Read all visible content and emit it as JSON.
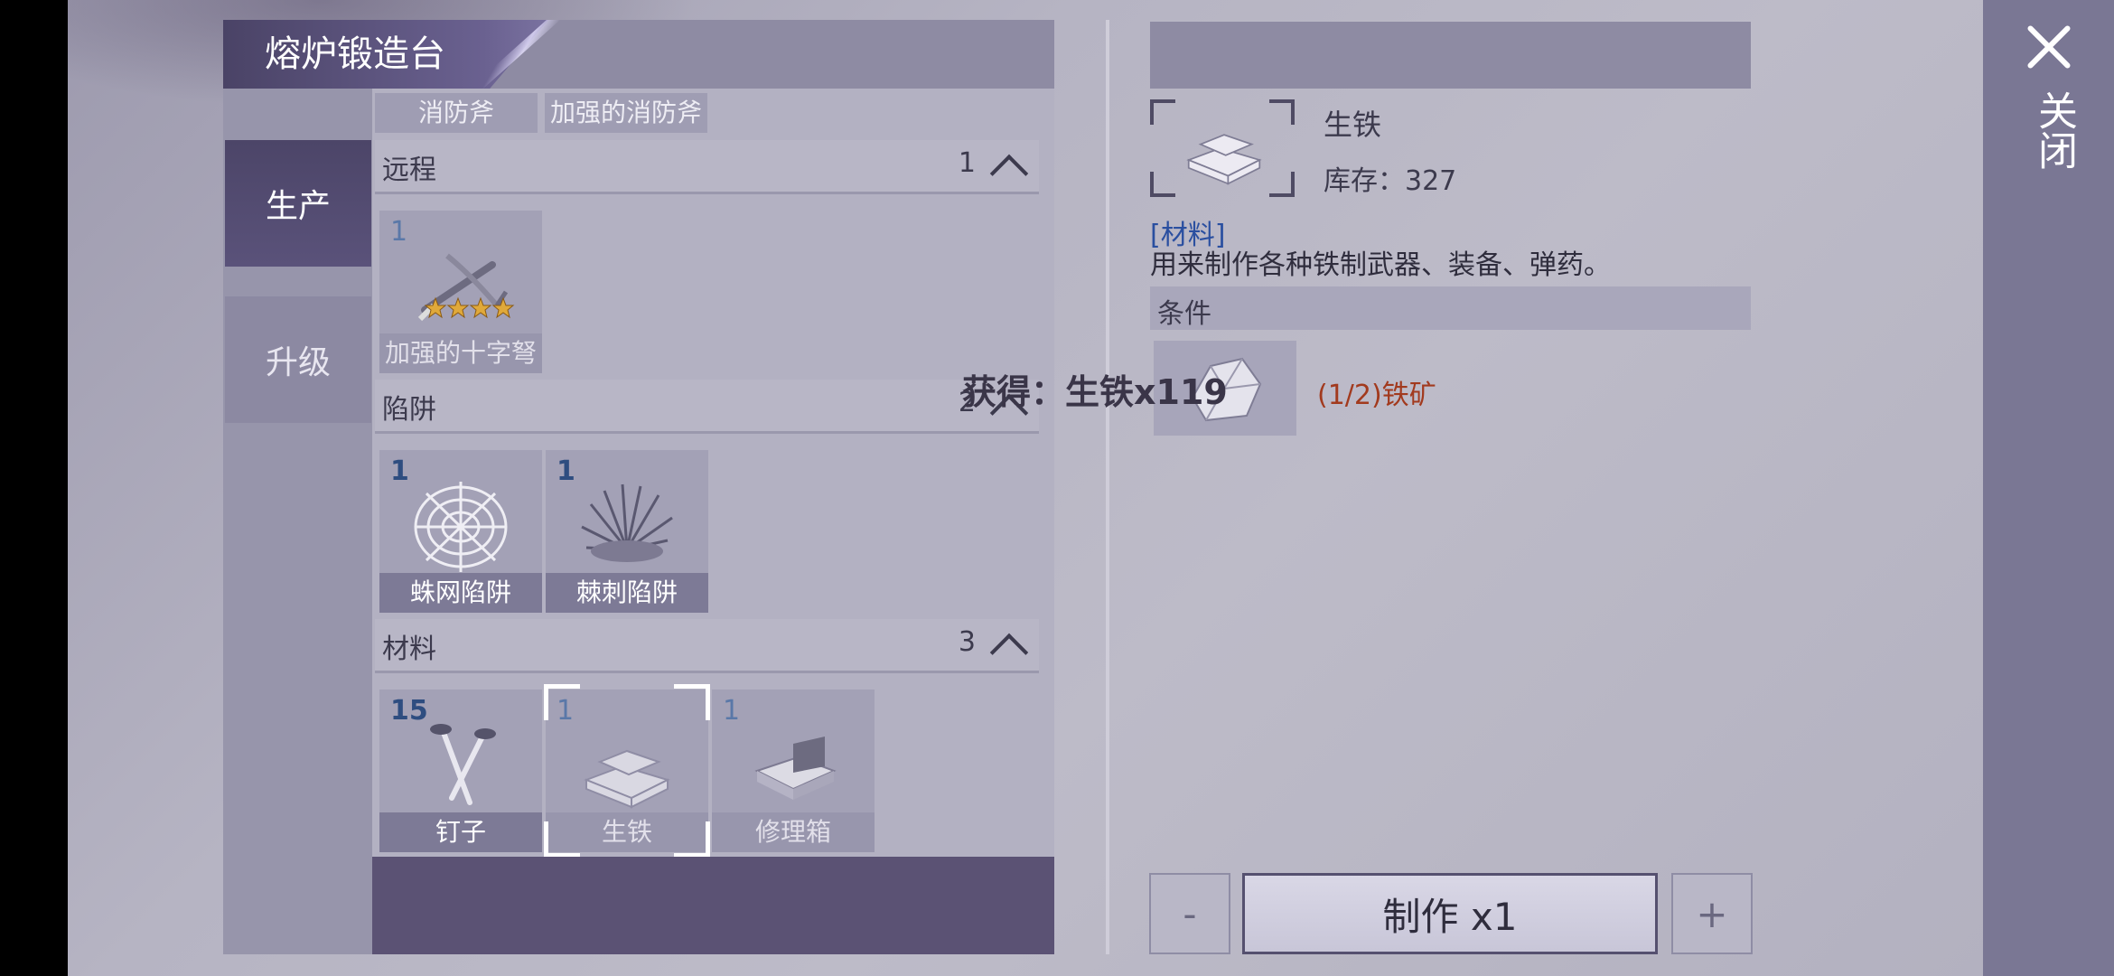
{
  "window": {
    "title": "熔炉锻造台",
    "close_label": "关闭"
  },
  "nav": {
    "production": "生产",
    "upgrade": "升级"
  },
  "top_chips": [
    "消防斧",
    "加强的消防斧"
  ],
  "sections": {
    "ranged": {
      "title": "远程",
      "count": "1",
      "items": [
        {
          "qty": "1",
          "name": "加强的十字弩",
          "stars": 4
        }
      ]
    },
    "traps": {
      "title": "陷阱",
      "count": "2",
      "items": [
        {
          "qty": "1",
          "name": "蛛网陷阱"
        },
        {
          "qty": "1",
          "name": "棘刺陷阱"
        }
      ]
    },
    "materials": {
      "title": "材料",
      "count": "3",
      "items": [
        {
          "qty": "15",
          "name": "钉子"
        },
        {
          "qty": "1",
          "name": "生铁"
        },
        {
          "qty": "1",
          "name": "修理箱"
        }
      ]
    }
  },
  "detail": {
    "name": "生铁",
    "stock": "库存：327",
    "category": "[材料]",
    "description": "用来制作各种铁制武器、装备、弹药。",
    "conditions_title": "条件",
    "condition_text": "(1/2)铁矿"
  },
  "toast": "获得：生铁x119",
  "controls": {
    "minus": "-",
    "make": "制作 x1",
    "plus": "+"
  },
  "colors": {
    "accent": "#5b5274",
    "condition_red": "#a23a1e",
    "category_blue": "#2a4fa0"
  }
}
